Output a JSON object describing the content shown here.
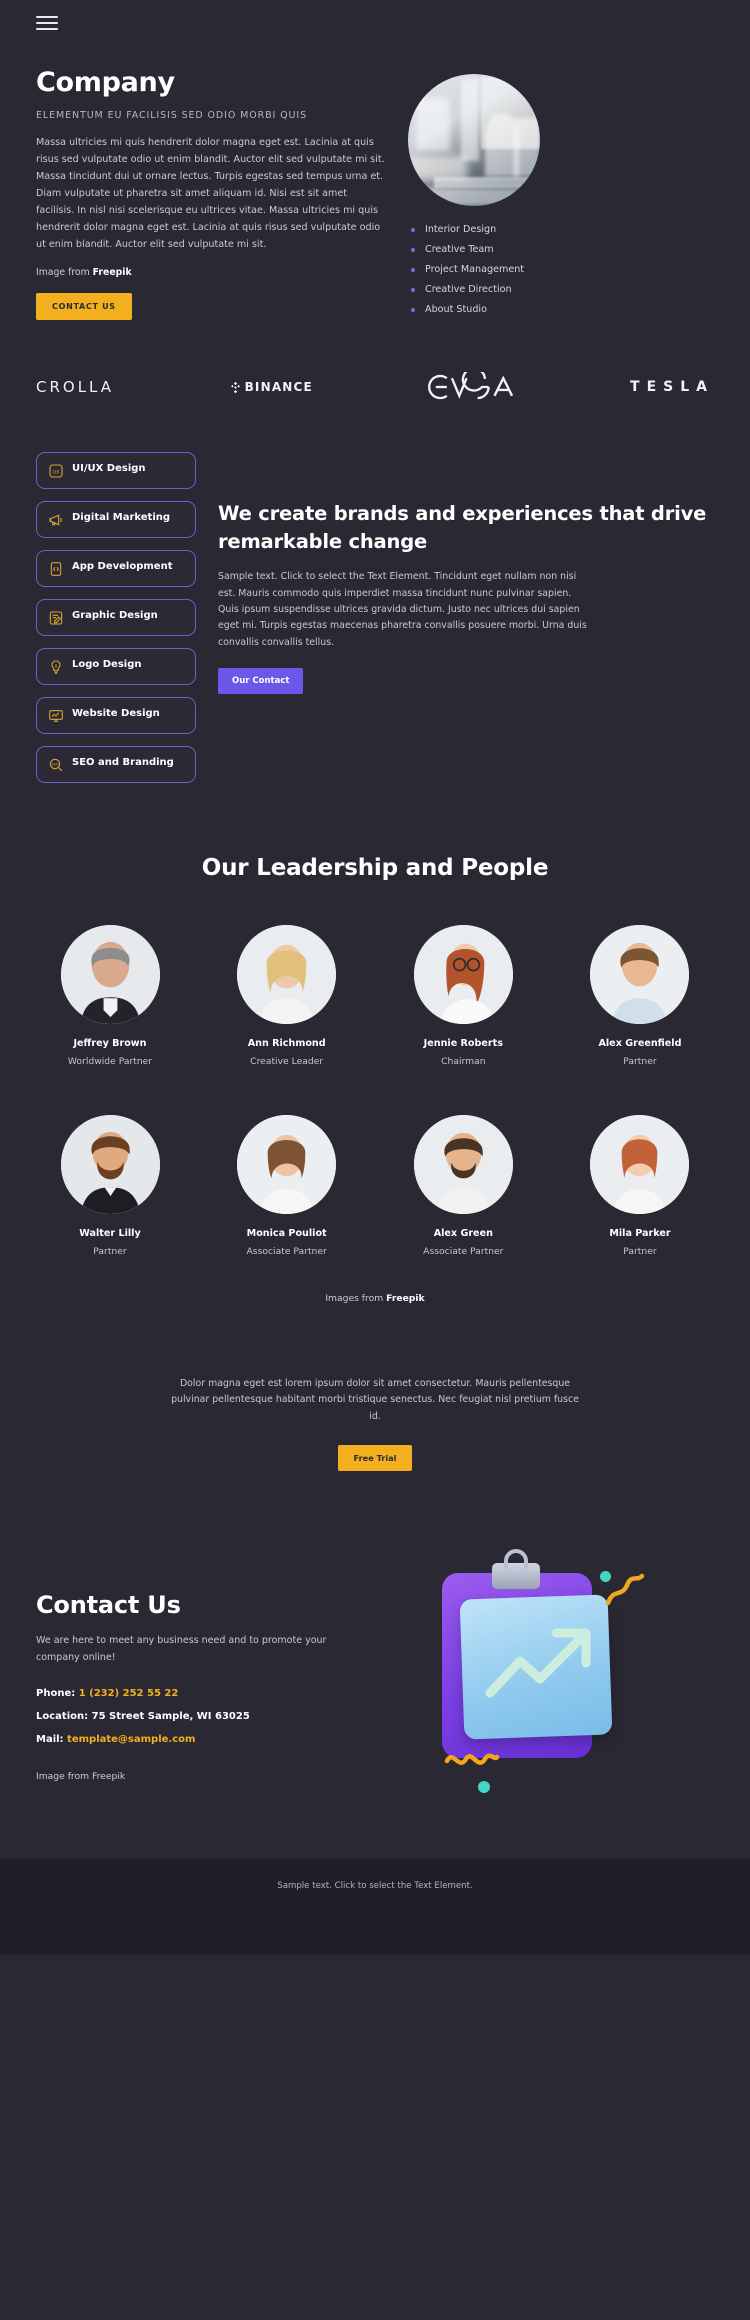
{
  "header": {
    "menu_icon": "hamburger-menu-icon"
  },
  "hero": {
    "title": "Company",
    "eyebrow": "ELEMENTUM EU FACILISIS SED ODIO MORBI QUIS",
    "body": "Massa ultricies mi quis hendrerit dolor magna eget est. Lacinia at quis risus sed vulputate odio ut enim blandit. Auctor elit sed vulputate mi sit. Massa tincidunt dui ut ornare lectus. Turpis egestas sed tempus urna et. Diam vulputate ut pharetra sit amet aliquam id. Nisi est sit amet facilisis. In nisl nisi scelerisque eu ultrices vitae. Massa ultricies mi quis hendrerit dolor magna eget est. Lacinia at quis risus sed vulputate odio ut enim blandit. Auctor elit sed vulputate mi sit.",
    "credit_prefix": "Image from ",
    "credit_brand": "Freepik",
    "cta_label": "CONTACT US",
    "photo_alt": "business-people-meeting-photo",
    "list": [
      "Interior Design",
      "Creative Team",
      "Project Management",
      "Creative Direction",
      "About Studio"
    ]
  },
  "logos": [
    {
      "name": "CROLLA",
      "key": "crolla"
    },
    {
      "name": "BINANCE",
      "key": "binance"
    },
    {
      "name": "EVGA",
      "key": "evga"
    },
    {
      "name": "TESLA",
      "key": "tesla"
    }
  ],
  "services": {
    "pills": [
      {
        "label": "UI/UX Design",
        "icon": "uiux-icon"
      },
      {
        "label": "Digital Marketing",
        "icon": "megaphone-icon"
      },
      {
        "label": "App Development",
        "icon": "code-file-icon"
      },
      {
        "label": "Graphic Design",
        "icon": "pencil-document-icon"
      },
      {
        "label": "Logo Design",
        "icon": "lightbulb-icon"
      },
      {
        "label": "Website Design",
        "icon": "monitor-chart-icon"
      },
      {
        "label": "SEO and Branding",
        "icon": "seo-magnifier-icon"
      }
    ],
    "title": "We create brands and experiences that drive remarkable change",
    "body": "Sample text. Click to select the Text Element. Tincidunt eget nullam non nisi est. Mauris commodo quis imperdiet massa tincidunt nunc pulvinar sapien. Quis ipsum suspendisse ultrices gravida dictum. Justo nec ultrices dui sapien eget mi. Turpis egestas maecenas pharetra convallis posuere morbi. Urna duis convallis convallis tellus.",
    "cta_label": "Our Contact",
    "accent": "#6b58e8",
    "pill_border": "#6f5fc4",
    "pill_icon_color": "#d8a62c"
  },
  "team": {
    "title": "Our Leadership and People",
    "members": [
      {
        "name": "Jeffrey Brown",
        "role": "Worldwide Partner"
      },
      {
        "name": "Ann Richmond",
        "role": "Creative Leader"
      },
      {
        "name": "Jennie Roberts",
        "role": "Chairman"
      },
      {
        "name": "Alex Greenfield",
        "role": "Partner"
      },
      {
        "name": "Walter Lilly",
        "role": "Partner"
      },
      {
        "name": "Monica Pouliot",
        "role": "Associate Partner"
      },
      {
        "name": "Alex Green",
        "role": "Associate Partner"
      },
      {
        "name": "Mila Parker",
        "role": "Partner"
      }
    ],
    "credit_prefix": "Images from ",
    "credit_brand": "Freepik"
  },
  "cta_band": {
    "text": "Dolor magna eget est lorem ipsum dolor sit amet consectetur. Mauris pellentesque pulvinar pellentesque habitant morbi tristique senectus. Nec feugiat nisl pretium fusce id.",
    "button_label": "Free Trial"
  },
  "contact": {
    "title": "Contact Us",
    "subtitle": "We are here to meet any business need and to promote your company online!",
    "phone_label": "Phone: ",
    "phone_value": "1 (232) 252 55 22",
    "location_label": "Location: ",
    "location_value": "75 Street Sample, WI 63025",
    "mail_label": "Mail: ",
    "mail_value": "template@sample.com",
    "credit": "Image from Freepik",
    "illustration_alt": "clipboard-growth-chart-illustration",
    "accent_amber": "#f2b01e"
  },
  "footer": {
    "text": "Sample text. Click to select the Text Element."
  },
  "theme": {
    "background": "#2a2833",
    "footer_background": "#201f29",
    "amber": "#f2b01e",
    "purple": "#6b58e8",
    "bullet": "#7b6bd8"
  }
}
